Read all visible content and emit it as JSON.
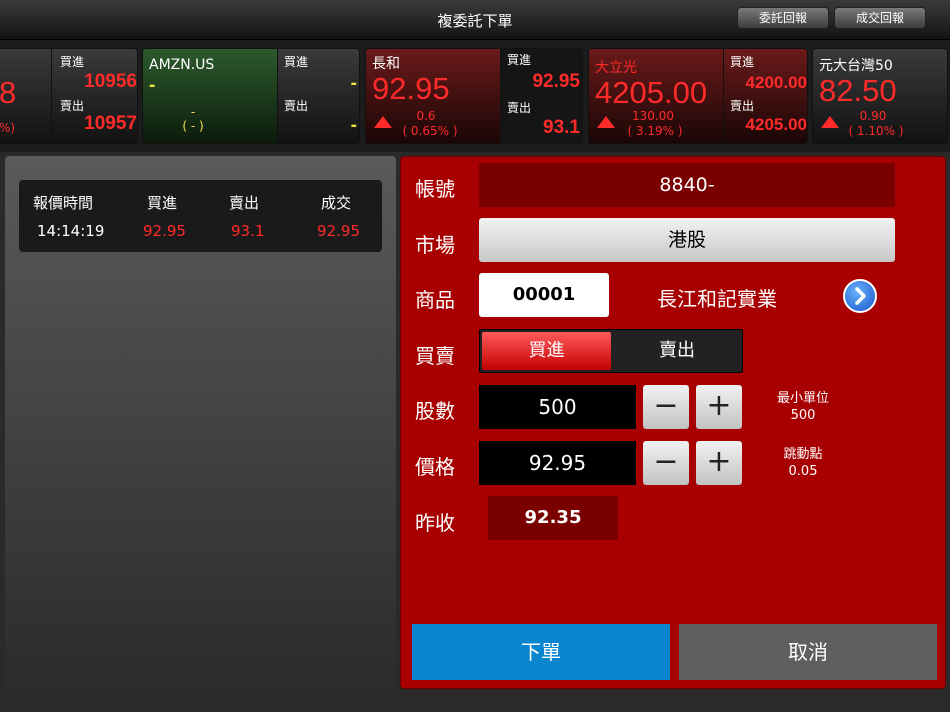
{
  "header": {
    "title": "複委託下單",
    "order_report_label": "委託回報",
    "trade_report_label": "成交回報"
  },
  "quotes": [
    {
      "name": "",
      "price": "8",
      "change_pct": "%)",
      "bid_label": "買進",
      "bid": "10956",
      "ask_label": "賣出",
      "ask": "10957"
    },
    {
      "name": "AMZN.US",
      "price": "-",
      "change": "-",
      "change_pct": "( - )",
      "bid_label": "買進",
      "bid": "-",
      "ask_label": "賣出",
      "ask": "-"
    },
    {
      "name": "長和",
      "price": "92.95",
      "change": "0.6",
      "change_pct": "( 0.65% )",
      "bid_label": "買進",
      "bid": "92.95",
      "ask_label": "賣出",
      "ask": "93.1"
    },
    {
      "name": "大立光",
      "price": "4205.00",
      "change": "130.00",
      "change_pct": "( 3.19% )",
      "bid_label": "買進",
      "bid": "4200.00",
      "ask_label": "賣出",
      "ask": "4205.00"
    },
    {
      "name": "元大台灣50",
      "price": "82.50",
      "change": "0.90",
      "change_pct": "( 1.10% )"
    }
  ],
  "quote_table": {
    "headers": [
      "報價時間",
      "買進",
      "賣出",
      "成交"
    ],
    "row": [
      "14:14:19",
      "92.95",
      "93.1",
      "92.95"
    ]
  },
  "form": {
    "account_label": "帳號",
    "account_value": "8840-",
    "market_label": "市場",
    "market_value": "港股",
    "product_label": "商品",
    "product_code": "00001",
    "product_name": "長江和記實業",
    "side_label": "買賣",
    "buy_label": "買進",
    "sell_label": "賣出",
    "shares_label": "股數",
    "shares_value": "500",
    "min_unit_label": "最小單位",
    "min_unit_value": "500",
    "price_label": "價格",
    "price_value": "92.95",
    "tick_label": "跳動點",
    "tick_value": "0.05",
    "prev_close_label": "昨收",
    "prev_close_value": "92.35",
    "minus": "−",
    "plus": "+",
    "submit_label": "下單",
    "cancel_label": "取消"
  }
}
